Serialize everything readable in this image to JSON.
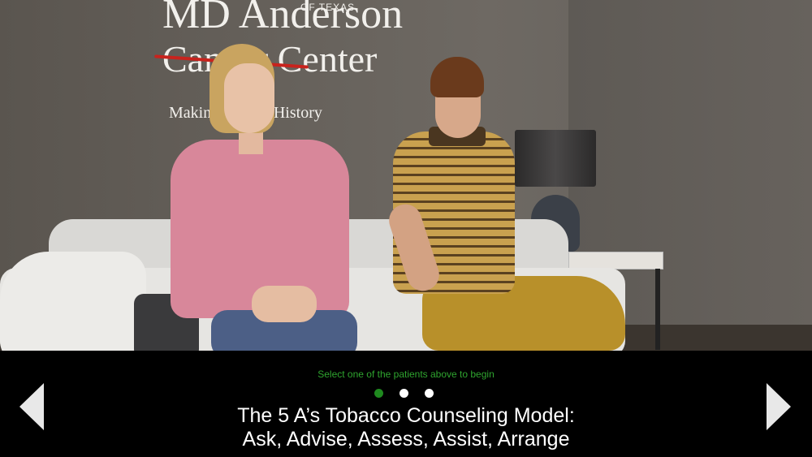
{
  "scene": {
    "logo": {
      "small_text": "OF TEXAS",
      "line1": "MD Anderson",
      "line2": "Cancer Center",
      "tagline": "Making Cancer History"
    },
    "patients": [
      {
        "id": "female-patient"
      },
      {
        "id": "male-patient"
      }
    ]
  },
  "controls": {
    "instruction": "Select one of the patients above to begin",
    "pagination": {
      "total": 3,
      "active_index": 0
    },
    "caption_line1": "The 5 A’s Tobacco Counseling Model:",
    "caption_line2": "Ask, Advise, Assess, Assist, Arrange",
    "prev_icon": "triangle-left-icon",
    "next_icon": "triangle-right-icon"
  },
  "colors": {
    "instruction": "#2fa52f",
    "active_dot": "#1f8a1f",
    "inactive_dot": "#ffffff",
    "logo_strike": "#c8231d"
  }
}
